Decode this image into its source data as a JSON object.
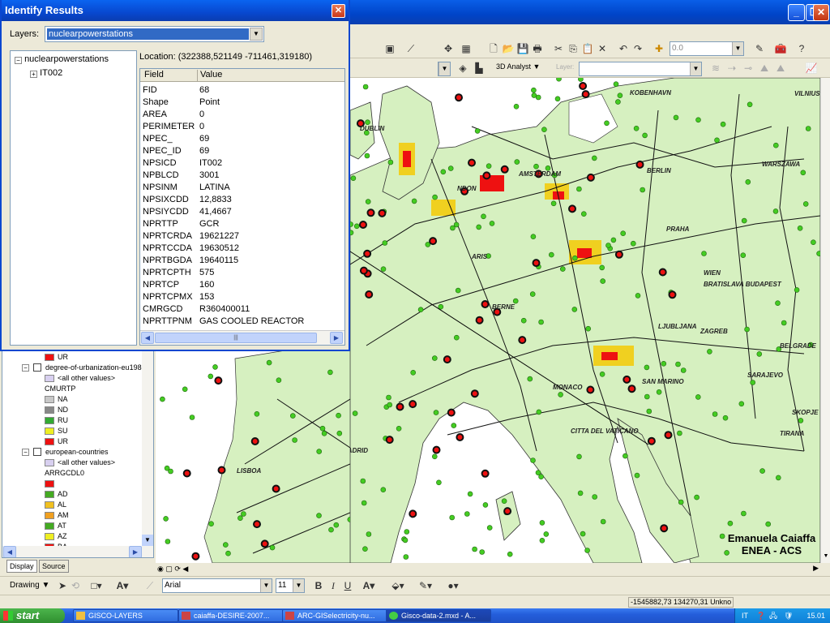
{
  "identify": {
    "title": "Identify Results",
    "close": "✕",
    "layers_label": "Layers:",
    "layers_value": "nuclearpowerstations",
    "tree_root": "nuclearpowerstations",
    "tree_child": "IT002",
    "location": "Location: (322388,521149 -711461,319180)",
    "col_field": "Field",
    "col_value": "Value",
    "rows": [
      {
        "field": "FID",
        "value": "68"
      },
      {
        "field": "Shape",
        "value": "Point"
      },
      {
        "field": "AREA",
        "value": "0"
      },
      {
        "field": "PERIMETER",
        "value": "0"
      },
      {
        "field": "NPEC_",
        "value": "69"
      },
      {
        "field": "NPEC_ID",
        "value": "69"
      },
      {
        "field": "NPSICD",
        "value": "IT002"
      },
      {
        "field": "NPBLCD",
        "value": "3001"
      },
      {
        "field": "NPSINM",
        "value": "LATINA"
      },
      {
        "field": "NPSIXCDD",
        "value": "12,8833"
      },
      {
        "field": "NPSIYCDD",
        "value": "41,4667"
      },
      {
        "field": "NPRTTP",
        "value": "GCR"
      },
      {
        "field": "NPRTCRDA",
        "value": "19621227"
      },
      {
        "field": "NPRTCCDA",
        "value": "19630512"
      },
      {
        "field": "NPRTBGDA",
        "value": "19640115"
      },
      {
        "field": "NPRTCPTH",
        "value": "575"
      },
      {
        "field": "NPRTCP",
        "value": "160"
      },
      {
        "field": "NPRTCPMX",
        "value": "153"
      },
      {
        "field": "CMRGCD",
        "value": "R360400011"
      },
      {
        "field": "NPRTTPNM",
        "value": "GAS COOLED REACTOR"
      }
    ],
    "hscroll_thumb": "|||"
  },
  "toolbar": {
    "scale_value": "0.0",
    "analyst_label": "3D Analyst ▼",
    "layer_label": "Layer:"
  },
  "toc": {
    "rows": [
      {
        "type": "item",
        "label": "UR",
        "color": "#ee1111",
        "indent": 1
      },
      {
        "type": "layer",
        "label": "degree-of-urbanization-eu198",
        "indent": 0
      },
      {
        "type": "item",
        "label": "<all other values>",
        "color": "#d8d0f0",
        "indent": 1
      },
      {
        "type": "text",
        "label": "CMURTP",
        "indent": 1
      },
      {
        "type": "item",
        "label": "NA",
        "color": "#c8c8c8",
        "indent": 1
      },
      {
        "type": "item",
        "label": "ND",
        "color": "#888888",
        "indent": 1
      },
      {
        "type": "item",
        "label": "RU",
        "color": "#33aa33",
        "indent": 1
      },
      {
        "type": "item",
        "label": "SU",
        "color": "#eeee22",
        "indent": 1
      },
      {
        "type": "item",
        "label": "UR",
        "color": "#ee1111",
        "indent": 1
      },
      {
        "type": "layer",
        "label": "european-countries",
        "indent": 0
      },
      {
        "type": "item",
        "label": "<all other values>",
        "color": "#d8d0f0",
        "indent": 1
      },
      {
        "type": "text",
        "label": "ARRGCDL0",
        "indent": 1
      },
      {
        "type": "item",
        "label": "",
        "color": "#ee1111",
        "indent": 1
      },
      {
        "type": "item",
        "label": "AD",
        "color": "#44aa22",
        "indent": 1
      },
      {
        "type": "item",
        "label": "AL",
        "color": "#f0c020",
        "indent": 1
      },
      {
        "type": "item",
        "label": "AM",
        "color": "#f0a020",
        "indent": 1
      },
      {
        "type": "item",
        "label": "AT",
        "color": "#44aa22",
        "indent": 1
      },
      {
        "type": "item",
        "label": "AZ",
        "color": "#eeee22",
        "indent": 1
      },
      {
        "type": "item",
        "label": "BA",
        "color": "#ee1111",
        "indent": 1
      }
    ],
    "tab_display": "Display",
    "tab_source": "Source"
  },
  "map": {
    "labels": [
      {
        "text": "KOBENHAVN"
      },
      {
        "text": "VILNIUS"
      },
      {
        "text": "DUBLIN"
      },
      {
        "text": "WARSZAWA"
      },
      {
        "text": "BERLIN"
      },
      {
        "text": "AMSTERDAM"
      },
      {
        "text": "NDON"
      },
      {
        "text": "PRAHA"
      },
      {
        "text": "WIEN"
      },
      {
        "text": "BRATISLAVA BUDAPEST"
      },
      {
        "text": "LJUBLJANA"
      },
      {
        "text": "ZAGREB"
      },
      {
        "text": "BELGRADE"
      },
      {
        "text": "SARAJEVO"
      },
      {
        "text": "SAN MARINO"
      },
      {
        "text": "MONACO"
      },
      {
        "text": "SKOPJE"
      },
      {
        "text": "TIRANA"
      },
      {
        "text": "CITTA DEL VATICANO"
      },
      {
        "text": "MADRID"
      },
      {
        "text": "LISBOA"
      },
      {
        "text": "BERNE"
      },
      {
        "text": "ARIS"
      }
    ],
    "credit_line1": "Emanuela Caiaffa",
    "credit_line2": "ENEA - ACS"
  },
  "drawing": {
    "label": "Drawing ▼",
    "font": "Arial",
    "size": "11",
    "bold": "B",
    "italic": "I",
    "underline": "U"
  },
  "status": {
    "coords": "-1545882,73  134270,31 Unkno"
  },
  "taskbar": {
    "start": "start",
    "items": [
      {
        "label": "GISCO-LAYERS"
      },
      {
        "label": "caiaffa-DESIRE-2007..."
      },
      {
        "label": "ARC-GISelectricity-nu..."
      },
      {
        "label": "Gisco-data-2.mxd - A..."
      }
    ],
    "tray_lang": "IT",
    "clock": "15.01"
  },
  "colors": {
    "land": "#d6f0c0",
    "urban_red": "#ee1111",
    "suburban_yellow": "#eeee22",
    "station_green": "#44cc22",
    "nuclear_black": "#111111"
  }
}
